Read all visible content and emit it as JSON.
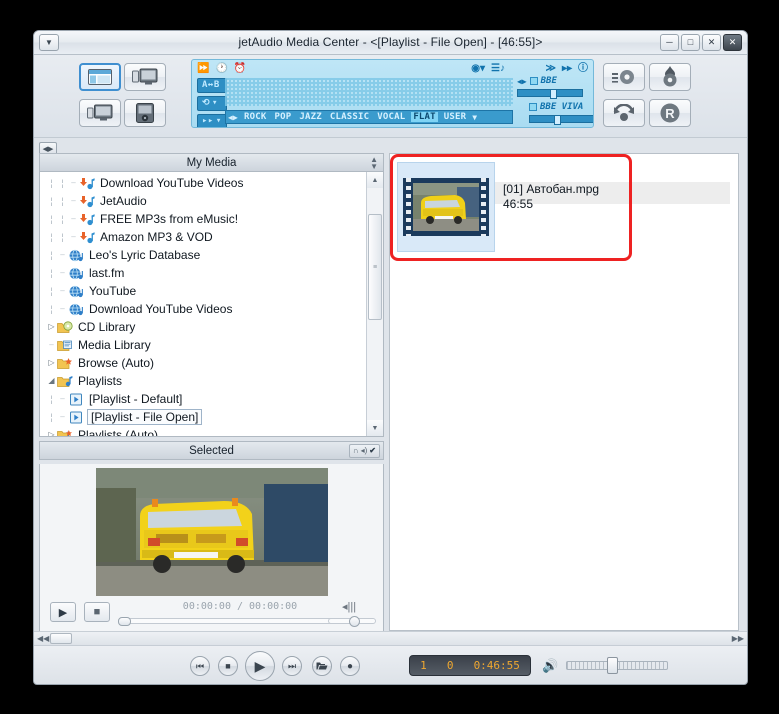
{
  "window": {
    "title": "jetAudio Media Center - <[Playlist - File Open] - [46:55]>",
    "sysmenu_icon": "▼",
    "buttons": [
      {
        "name": "minimize",
        "glyph": "─"
      },
      {
        "name": "maximize",
        "glyph": "□"
      },
      {
        "name": "close",
        "glyph": "✕"
      },
      {
        "name": "exit",
        "glyph": "✕"
      }
    ]
  },
  "toolbar": {
    "collapse_handle": "◀▶",
    "mode_buttons": [
      {
        "name": "library-view-button",
        "icon": "library-layout-icon",
        "selected": true
      },
      {
        "name": "media-center-button",
        "icon": "monitor-icon",
        "selected": false
      },
      {
        "name": "mini-player-button",
        "icon": "monitor-small-icon",
        "selected": false
      },
      {
        "name": "device-button",
        "icon": "portable-device-icon",
        "selected": false
      }
    ],
    "right_buttons": [
      {
        "name": "cd-rip-button",
        "icon": "disc-rip-icon"
      },
      {
        "name": "burn-button",
        "icon": "flame-disc-icon"
      },
      {
        "name": "convert-button",
        "icon": "convert-icon"
      },
      {
        "name": "record-button",
        "icon": "record-r-icon"
      }
    ]
  },
  "equalizer": {
    "top_icons_left": [
      "fast-forward-icon",
      "clock-icon",
      "alarm-icon"
    ],
    "top_icons_right": [
      "shuffle-icon",
      "playlist-note-icon",
      "crossfade-icon",
      "next-track-icon",
      "info-icon"
    ],
    "side_buttons": [
      {
        "name": "ab-repeat-button",
        "label": "A↔B"
      },
      {
        "name": "repeat-mode-button",
        "label": "⟲"
      },
      {
        "name": "playback-order-button",
        "label": "▸▸"
      }
    ],
    "presets": [
      {
        "label": "ROCK",
        "active": false
      },
      {
        "label": "POP",
        "active": false
      },
      {
        "label": "JAZZ",
        "active": false
      },
      {
        "label": "CLASSIC",
        "active": false
      },
      {
        "label": "VOCAL",
        "active": false
      },
      {
        "label": "FLAT",
        "active": true
      },
      {
        "label": "USER",
        "active": false
      }
    ],
    "preset_nav": "◀▶",
    "preset_dropdown": "▼",
    "bbe": {
      "label": "BBE",
      "checked": true,
      "value": 50
    },
    "bbe_viva": {
      "label": "BBE VIVA",
      "checked": true,
      "value": 38
    }
  },
  "my_media": {
    "header": "My Media",
    "tree": [
      {
        "label": "Download YouTube Videos",
        "depth": 3,
        "icon": "download-note-icon",
        "twisty": "",
        "selected": false
      },
      {
        "label": "JetAudio",
        "depth": 3,
        "icon": "download-note-icon",
        "twisty": "",
        "selected": false
      },
      {
        "label": "FREE MP3s from eMusic!",
        "depth": 3,
        "icon": "download-note-icon",
        "twisty": "",
        "selected": false
      },
      {
        "label": "Amazon MP3 & VOD",
        "depth": 3,
        "icon": "download-note-icon",
        "twisty": "",
        "selected": false
      },
      {
        "label": "Leo's Lyric Database",
        "depth": 2,
        "icon": "globe-note-icon",
        "twisty": "",
        "selected": false
      },
      {
        "label": "last.fm",
        "depth": 2,
        "icon": "globe-note-icon",
        "twisty": "",
        "selected": false
      },
      {
        "label": "YouTube",
        "depth": 2,
        "icon": "globe-note-icon",
        "twisty": "",
        "selected": false
      },
      {
        "label": "Download YouTube Videos",
        "depth": 2,
        "icon": "globe-note-icon",
        "twisty": "",
        "selected": false
      },
      {
        "label": "CD Library",
        "depth": 1,
        "icon": "cd-folder-icon",
        "twisty": "▷",
        "selected": false
      },
      {
        "label": "Media Library",
        "depth": 1,
        "icon": "media-folder-icon",
        "twisty": "",
        "selected": false
      },
      {
        "label": "Browse (Auto)",
        "depth": 1,
        "icon": "browse-folder-icon",
        "twisty": "▷",
        "selected": false
      },
      {
        "label": "Playlists",
        "depth": 1,
        "icon": "playlist-folder-icon",
        "twisty": "◢",
        "selected": false
      },
      {
        "label": "[Playlist - Default]",
        "depth": 2,
        "icon": "playlist-file-icon",
        "twisty": "",
        "selected": false
      },
      {
        "label": "[Playlist - File Open]",
        "depth": 2,
        "icon": "playlist-file-icon",
        "twisty": "",
        "selected": true
      },
      {
        "label": "Playlists (Auto)",
        "depth": 1,
        "icon": "playlist-auto-folder-icon",
        "twisty": "▷",
        "selected": false
      }
    ]
  },
  "selected_panel": {
    "header": "Selected",
    "header_controls": [
      "headphone-icon",
      "speaker-icon",
      "check-icon"
    ],
    "play_button": "▶",
    "stop_button": "■",
    "time": "00:00:00 / 00:00:00",
    "volume_icon": "speaker-icon"
  },
  "playlist": {
    "items": [
      {
        "title": "[01] Автобан.mpg",
        "duration": "46:55",
        "thumbnail": "video-filmstrip-icon"
      }
    ]
  },
  "transport": {
    "buttons": [
      {
        "name": "previous-button",
        "glyph": "⏮"
      },
      {
        "name": "stop-button",
        "glyph": "■"
      },
      {
        "name": "play-button",
        "glyph": "▶"
      },
      {
        "name": "next-button",
        "glyph": "⏭"
      },
      {
        "name": "open-file-button",
        "glyph": "📂"
      },
      {
        "name": "record-button",
        "glyph": "●"
      }
    ],
    "lcd": {
      "track_number": "1",
      "secondary": "0",
      "time": "0:46:55"
    },
    "volume_icon": "volume-speaker-icon"
  },
  "scrollbars": {
    "left_arrows": "◀◀",
    "right_arrows": "▶▶",
    "up_arrow": "▲",
    "down_arrow": "▼"
  },
  "colors": {
    "accent": "#3f8fd0",
    "eq_bg": "#b3e1f4",
    "highlight_red": "#ee2222",
    "lcd_text": "#f0a830"
  }
}
